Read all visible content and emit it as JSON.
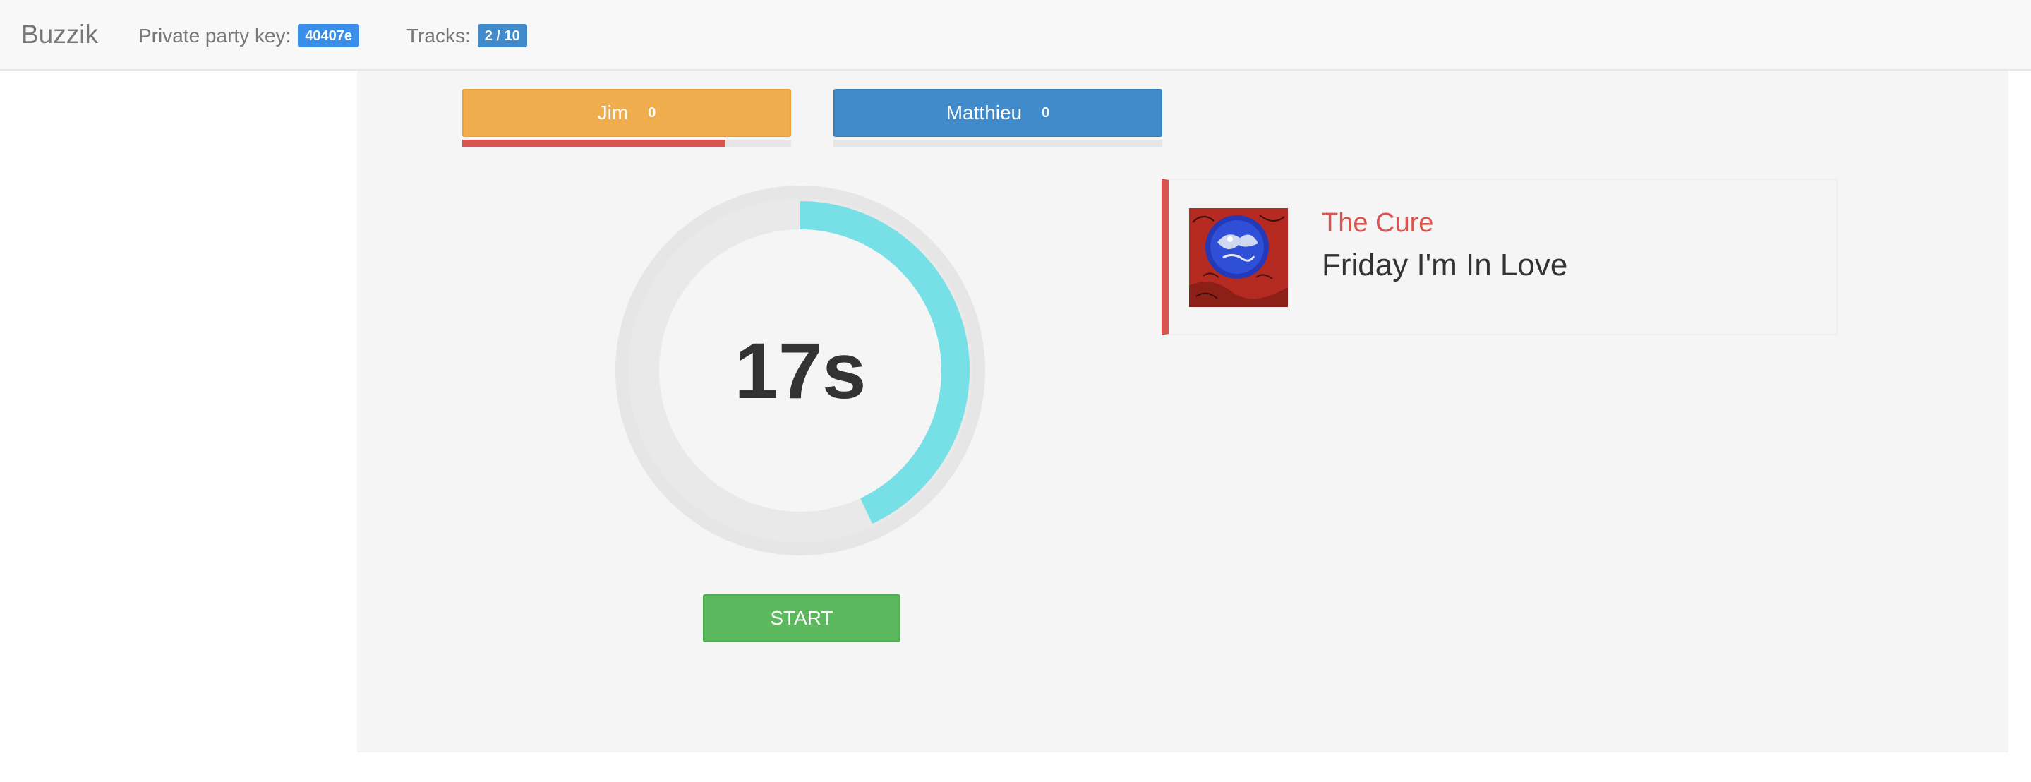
{
  "navbar": {
    "brand": "Buzzik",
    "party_key_label": "Private party key:",
    "party_key_value": "40407e",
    "tracks_label": "Tracks:",
    "tracks_value": "2 / 10"
  },
  "players": [
    {
      "name": "Jim",
      "score": "0",
      "color": "#f0ad4e",
      "progress_fraction": 0.8
    },
    {
      "name": "Matthieu",
      "score": "0",
      "color": "#428bca",
      "progress_fraction": 0.0
    }
  ],
  "timer": {
    "text": "17s",
    "elapsed_fraction": 0.43,
    "ring_color": "#76e0e6"
  },
  "start_button": {
    "label": "START",
    "color": "#5cb85c"
  },
  "track": {
    "artist": "The Cure",
    "title": "Friday I'm In Love",
    "accent_color": "#d9534f",
    "cover_icon": "album-cover-image"
  }
}
